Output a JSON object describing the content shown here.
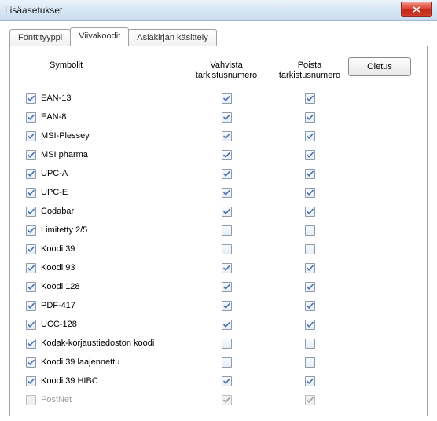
{
  "window": {
    "title": "Lisäasetukset"
  },
  "tabs": [
    {
      "label": "Fonttityyppi",
      "active": false
    },
    {
      "label": "Viivakoodit",
      "active": true
    },
    {
      "label": "Asiakirjan käsittely",
      "active": false
    }
  ],
  "buttons": {
    "default": "Oletus"
  },
  "headers": {
    "symbols": "Symbolit",
    "verify": "Vahvista tarkistusnumero",
    "remove": "Poista tarkistusnumero"
  },
  "rows": [
    {
      "label": "EAN-13",
      "sym": true,
      "verify": true,
      "remove": true,
      "disabled": false
    },
    {
      "label": "EAN-8",
      "sym": true,
      "verify": true,
      "remove": true,
      "disabled": false
    },
    {
      "label": "MSI-Plessey",
      "sym": true,
      "verify": true,
      "remove": true,
      "disabled": false
    },
    {
      "label": "MSI pharma",
      "sym": true,
      "verify": true,
      "remove": true,
      "disabled": false
    },
    {
      "label": "UPC-A",
      "sym": true,
      "verify": true,
      "remove": true,
      "disabled": false
    },
    {
      "label": "UPC-E",
      "sym": true,
      "verify": true,
      "remove": true,
      "disabled": false
    },
    {
      "label": "Codabar",
      "sym": true,
      "verify": true,
      "remove": true,
      "disabled": false
    },
    {
      "label": "Limitetty 2/5",
      "sym": true,
      "verify": false,
      "remove": false,
      "disabled": false
    },
    {
      "label": "Koodi 39",
      "sym": true,
      "verify": false,
      "remove": false,
      "disabled": false
    },
    {
      "label": "Koodi 93",
      "sym": true,
      "verify": true,
      "remove": true,
      "disabled": false
    },
    {
      "label": "Koodi 128",
      "sym": true,
      "verify": true,
      "remove": true,
      "disabled": false
    },
    {
      "label": "PDF-417",
      "sym": true,
      "verify": true,
      "remove": true,
      "disabled": false
    },
    {
      "label": "UCC-128",
      "sym": true,
      "verify": true,
      "remove": true,
      "disabled": false
    },
    {
      "label": "Kodak-korjaustiedoston koodi",
      "sym": true,
      "verify": false,
      "remove": false,
      "disabled": false
    },
    {
      "label": "Koodi 39 laajennettu",
      "sym": true,
      "verify": false,
      "remove": false,
      "disabled": false
    },
    {
      "label": "Koodi 39 HIBC",
      "sym": true,
      "verify": true,
      "remove": true,
      "disabled": false
    },
    {
      "label": "PostNet",
      "sym": false,
      "verify": true,
      "remove": true,
      "disabled": true
    }
  ]
}
